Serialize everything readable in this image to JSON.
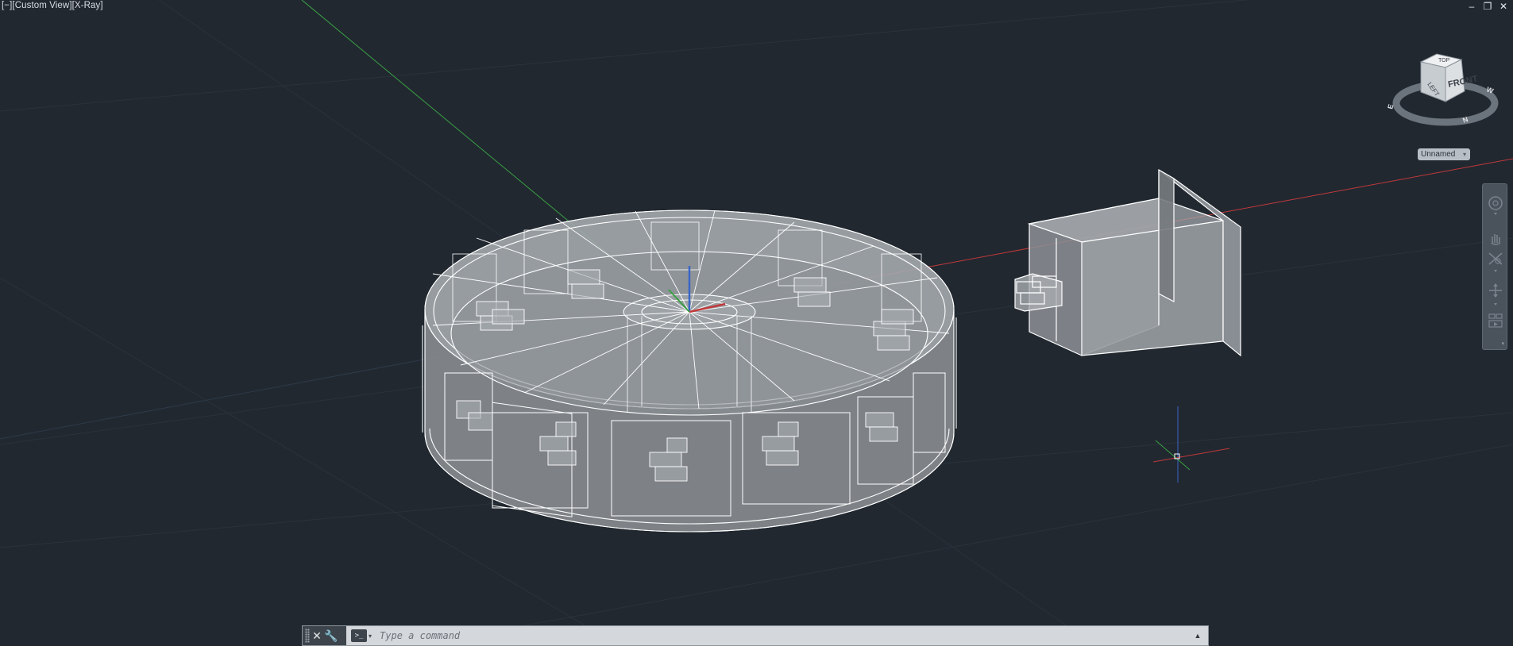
{
  "viewport": {
    "label": "[−][Custom View][X-Ray]",
    "window_controls": {
      "minimize": "‒",
      "restore": "❐",
      "close": "✕"
    }
  },
  "viewcube": {
    "face_front": "FRONT",
    "face_top": "TOP",
    "face_left": "LEFT",
    "compass_w": "W",
    "compass_n": "N",
    "compass_e": "E",
    "ucs_label": "Unnamed"
  },
  "navigation_bar": {
    "tools": [
      "steering-wheel-icon",
      "pan-icon",
      "zoom-extents-icon",
      "orbit-icon",
      "showmotion-icon"
    ]
  },
  "command_line": {
    "placeholder": "Type a command",
    "close_label": "✕",
    "customize_label": "🔧",
    "prompt_label": ">_",
    "history_label": "▲"
  },
  "colors": {
    "background": "#212830",
    "axis_x": "#c0393b",
    "axis_y": "#3aa043",
    "axis_z": "#3a66c8",
    "wireframe": "#ffffff",
    "xray_fill": "#9a9ea3"
  }
}
